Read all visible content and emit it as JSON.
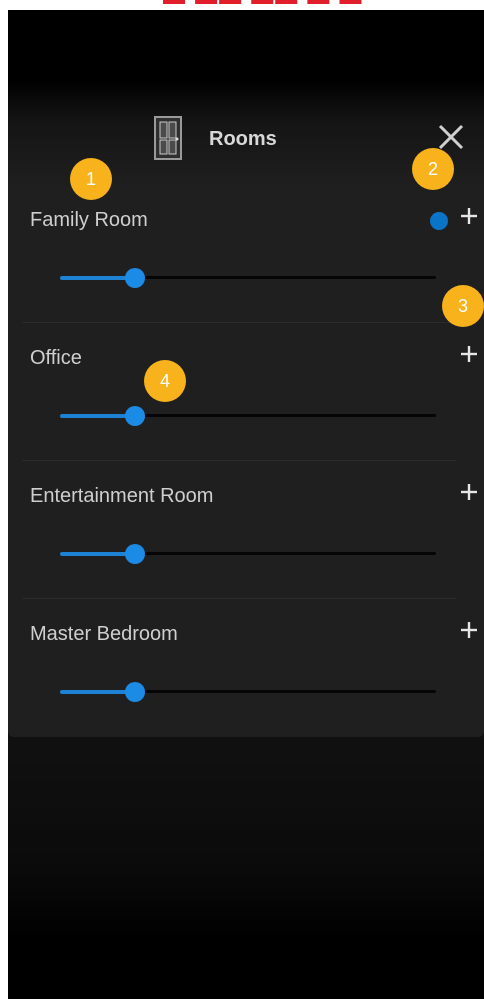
{
  "header": {
    "title": "Rooms",
    "door_icon": "room-door-icon",
    "close_icon": "close-icon"
  },
  "rooms": [
    {
      "name": "Family Room",
      "level": 0.2,
      "active": true
    },
    {
      "name": "Office",
      "level": 0.2,
      "active": false
    },
    {
      "name": "Entertainment Room",
      "level": 0.2,
      "active": false
    },
    {
      "name": "Master Bedroom",
      "level": 0.2,
      "active": false
    }
  ],
  "callouts": [
    {
      "label": "1"
    },
    {
      "label": "2"
    },
    {
      "label": "3"
    },
    {
      "label": "4"
    }
  ],
  "colors": {
    "accent": "#1b8be6",
    "callout": "#f7b21c",
    "top_text": "#e11d2a"
  }
}
